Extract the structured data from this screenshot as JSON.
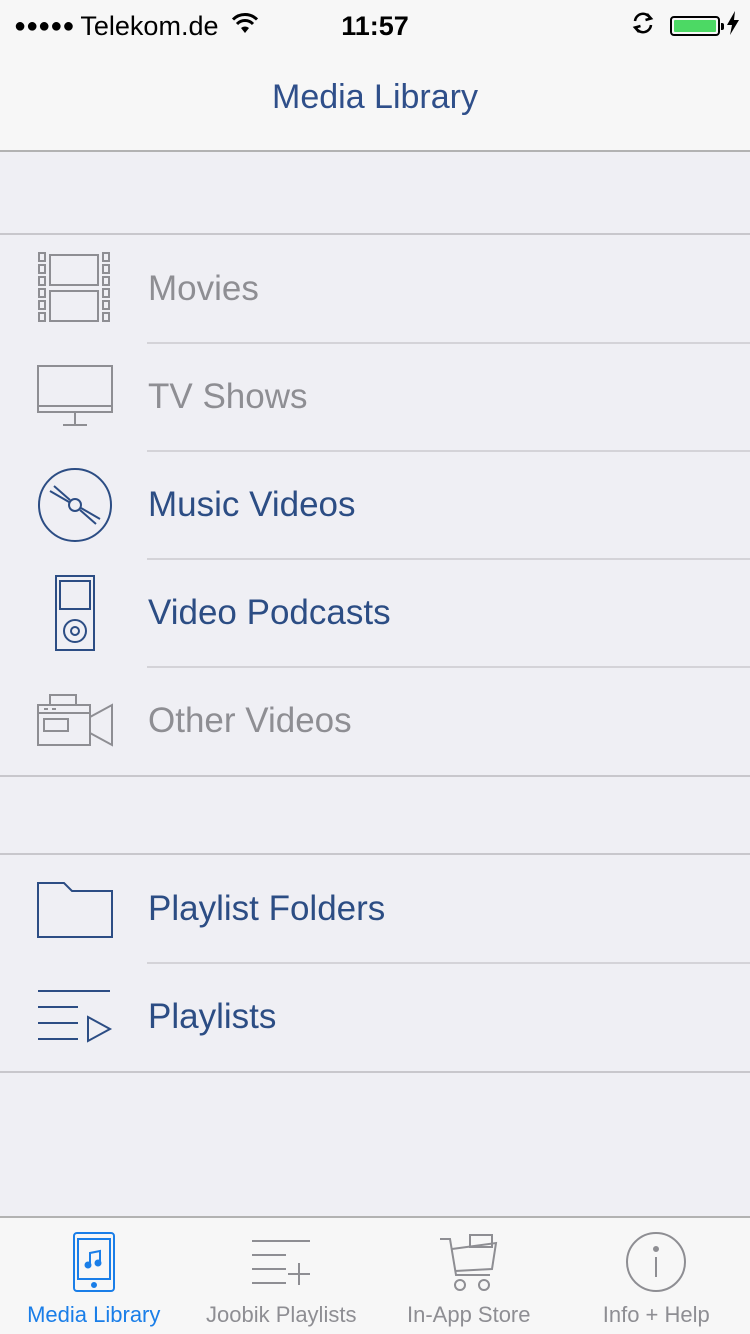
{
  "status_bar": {
    "signal": "●●●●●",
    "carrier": "Telekom.de",
    "time": "11:57",
    "battery_level_percent": 100,
    "battery_color": "#4cd964"
  },
  "nav": {
    "title": "Media Library"
  },
  "colors": {
    "enabled_text": "#2c4d84",
    "disabled_text": "#8e8e93",
    "active_tab": "#1a7ee8",
    "inactive_tab": "#8e8e93"
  },
  "sections": {
    "videos": [
      {
        "label": "Movies",
        "icon": "film-icon",
        "enabled": false
      },
      {
        "label": "TV Shows",
        "icon": "tv-icon",
        "enabled": false
      },
      {
        "label": "Music Videos",
        "icon": "disc-icon",
        "enabled": true
      },
      {
        "label": "Video Podcasts",
        "icon": "ipod-icon",
        "enabled": true
      },
      {
        "label": "Other Videos",
        "icon": "camcorder-icon",
        "enabled": false
      }
    ],
    "playlists": [
      {
        "label": "Playlist Folders",
        "icon": "folder-icon",
        "enabled": true
      },
      {
        "label": "Playlists",
        "icon": "playlist-icon",
        "enabled": true
      }
    ]
  },
  "tabs": [
    {
      "label": "Media Library",
      "icon": "phone-music-icon",
      "active": true
    },
    {
      "label": "Joobik Playlists",
      "icon": "add-playlist-icon",
      "active": false
    },
    {
      "label": "In-App Store",
      "icon": "cart-icon",
      "active": false
    },
    {
      "label": "Info + Help",
      "icon": "info-icon",
      "active": false
    }
  ]
}
